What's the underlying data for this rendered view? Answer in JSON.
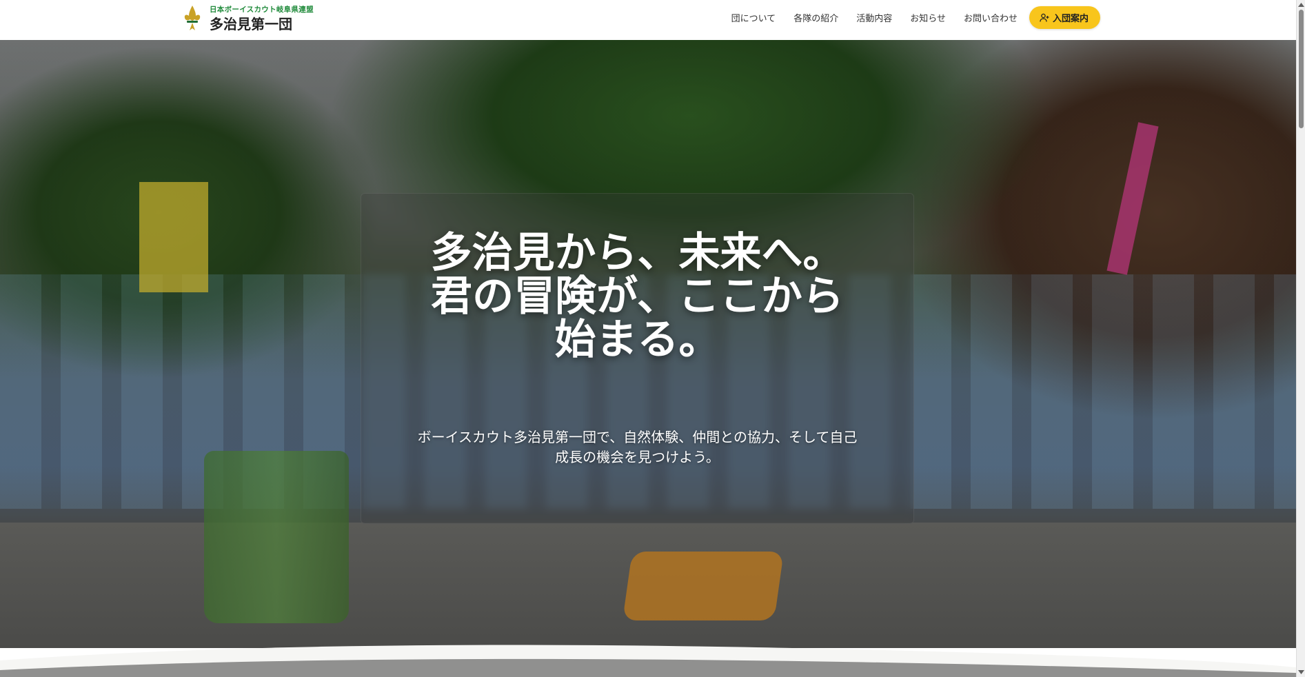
{
  "header": {
    "org_subtitle": "日本ボーイスカウト岐阜県連盟",
    "org_title": "多治見第一団",
    "logo_icon": "fleur-de-lis-icon",
    "nav_items": [
      {
        "label": "団について"
      },
      {
        "label": "各隊の紹介"
      },
      {
        "label": "活動内容"
      },
      {
        "label": "お知らせ"
      },
      {
        "label": "お問い合わせ"
      }
    ],
    "join_button": {
      "label": "入団案内",
      "icon": "user-plus-icon"
    }
  },
  "hero": {
    "headline_lines": [
      "多治見から、未来へ。",
      "君の冒険が、ここから",
      "始まる。"
    ],
    "subtext_lines": [
      "ボーイスカウト多治見第一団で、自然体験、仲間との協力、そして自己",
      "成長の機会を見つけよう。"
    ]
  },
  "colors": {
    "brand_green": "#1f8a3a",
    "accent_yellow": "#f8c51c",
    "text_dark": "#222222"
  }
}
